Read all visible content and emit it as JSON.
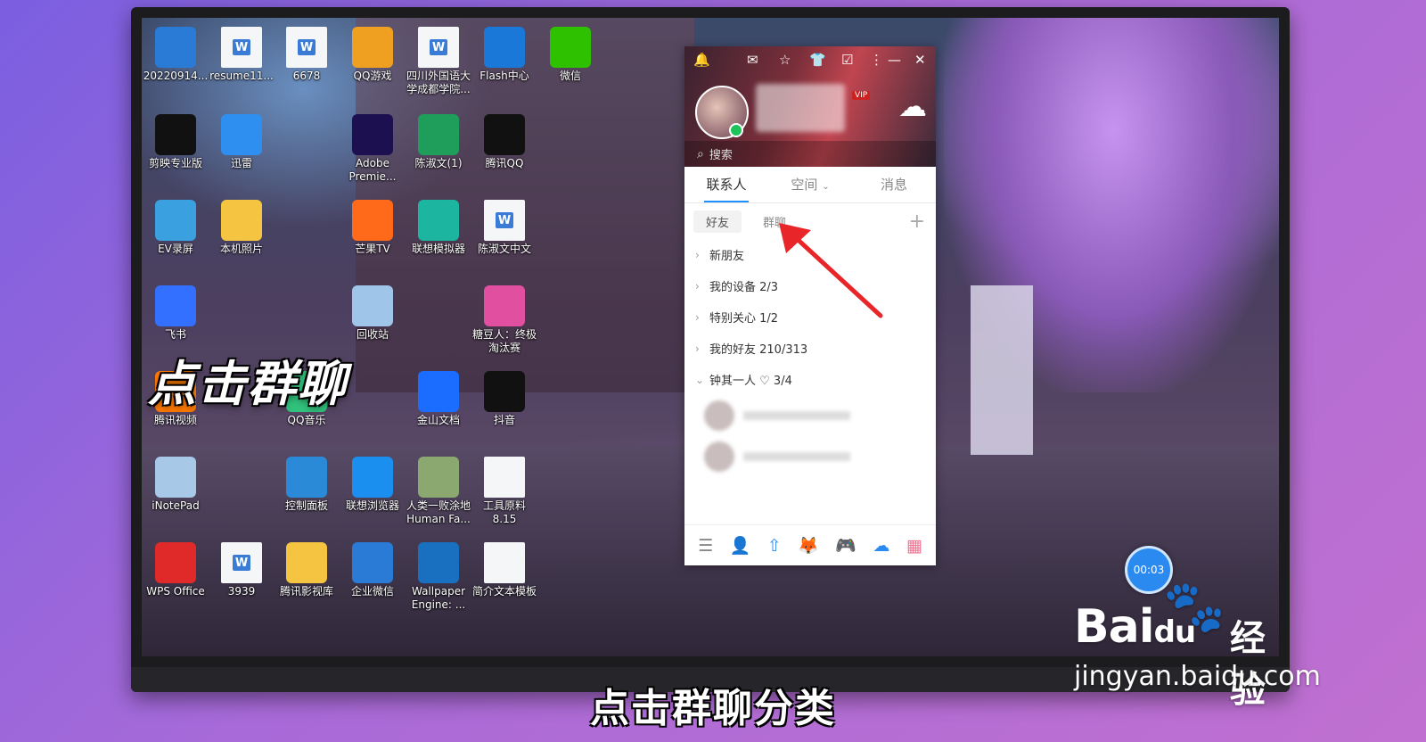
{
  "desktop_icons": [
    {
      "label": "20220914...",
      "icon": "video-file-icon",
      "color": "#2a7bd5"
    },
    {
      "label": "resume11...",
      "icon": "word-doc-icon",
      "color": "#3a7bd5"
    },
    {
      "label": "6678",
      "icon": "word-doc-icon",
      "color": "#3a7bd5"
    },
    {
      "label": "QQ游戏",
      "icon": "qq-game-icon",
      "color": "#f0a020"
    },
    {
      "label": "四川外国语大学成都学院...",
      "icon": "word-doc-icon",
      "color": "#3a7bd5"
    },
    {
      "label": "Flash中心",
      "icon": "flash-icon",
      "color": "#1a78d8"
    },
    {
      "label": "微信",
      "icon": "wechat-icon",
      "color": "#2dc100"
    },
    {
      "label": "剪映专业版",
      "icon": "capcut-icon",
      "color": "#111111"
    },
    {
      "label": "迅雷",
      "icon": "xunlei-icon",
      "color": "#2f8ff0"
    },
    {
      "label": "Adobe Premie...",
      "icon": "premiere-icon",
      "color": "#1d1050"
    },
    {
      "label": "陈淑文(1)",
      "icon": "sheet-file-icon",
      "color": "#1e9e5a"
    },
    {
      "label": "腾讯QQ",
      "icon": "qq-penguin-icon",
      "color": "#111111"
    },
    {
      "label": "EV录屏",
      "icon": "ev-recorder-icon",
      "color": "#3aa0e0"
    },
    {
      "label": "本机照片",
      "icon": "folder-icon",
      "color": "#f5c542"
    },
    {
      "label": "芒果TV",
      "icon": "mango-tv-icon",
      "color": "#ff6a1a"
    },
    {
      "label": "联想模拟器",
      "icon": "emulator-icon",
      "color": "#1cb5a0"
    },
    {
      "label": "陈淑文中文",
      "icon": "word-doc-icon",
      "color": "#3a7bd5"
    },
    {
      "label": "飞书",
      "icon": "feishu-icon",
      "color": "#3370ff"
    },
    {
      "label": "回收站",
      "icon": "recycle-bin-icon",
      "color": "#9fc5e8"
    },
    {
      "label": "糖豆人：终极淘汰赛",
      "icon": "fall-guys-icon",
      "color": "#e04fa0"
    },
    {
      "label": "腾讯视频",
      "icon": "tencent-video-icon",
      "color": "#ff7a00"
    },
    {
      "label": "QQ音乐",
      "icon": "qq-music-icon",
      "color": "#31c27c"
    },
    {
      "label": "金山文档",
      "icon": "kdocs-icon",
      "color": "#1a6dff"
    },
    {
      "label": "抖音",
      "icon": "douyin-icon",
      "color": "#111111"
    },
    {
      "label": "iNotePad",
      "icon": "notepad-icon",
      "color": "#a8c8e8"
    },
    {
      "label": "控制面板",
      "icon": "control-panel-icon",
      "color": "#2a8ad8"
    },
    {
      "label": "联想浏览器",
      "icon": "lenovo-browser-icon",
      "color": "#1a8ff0"
    },
    {
      "label": "人类一败涂地 Human Fa...",
      "icon": "human-fall-flat-icon",
      "color": "#8aa870"
    },
    {
      "label": "工具原料 8.15",
      "icon": "blank-doc-icon",
      "color": "#f4f6f8"
    },
    {
      "label": "WPS Office",
      "icon": "wps-icon",
      "color": "#e02a2a"
    },
    {
      "label": "3939",
      "icon": "word-doc-icon",
      "color": "#3a7bd5"
    },
    {
      "label": "腾讯影视库",
      "icon": "video-folder-icon",
      "color": "#f5c542"
    },
    {
      "label": "企业微信",
      "icon": "wecom-icon",
      "color": "#2a7bd5"
    },
    {
      "label": "Wallpaper Engine: ...",
      "icon": "wallpaper-engine-icon",
      "color": "#1a70c0"
    },
    {
      "label": "简介文本模板",
      "icon": "blank-doc-icon",
      "color": "#f4f6f8"
    }
  ],
  "overlay_title": "点击群聊",
  "qq": {
    "search_placeholder": "搜索",
    "vip_badge": "VIP",
    "tabs": [
      "联系人",
      "空间",
      "消息"
    ],
    "subtabs": [
      "好友",
      "群聊"
    ],
    "groups": [
      {
        "label": "新朋友",
        "expanded": false
      },
      {
        "label": "我的设备 2/3",
        "expanded": false
      },
      {
        "label": "特别关心 1/2",
        "expanded": false
      },
      {
        "label": "我的好友 210/313",
        "expanded": false
      },
      {
        "label": "钟其一人 ♡ 3/4",
        "expanded": true
      }
    ],
    "accent": "#1e90ff"
  },
  "timer": "00:03",
  "watermark": {
    "brand": "Bai",
    "brand_suffix": "du",
    "jingyan": "经验",
    "url": "jingyan.baidu.com"
  },
  "subtitle": "点击群聊分类"
}
